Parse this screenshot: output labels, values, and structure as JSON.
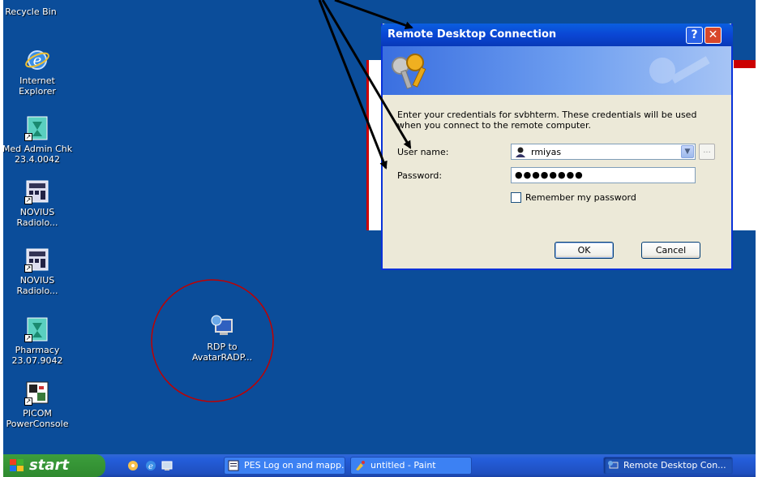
{
  "desktop": {
    "icons": [
      {
        "label": "Recycle Bin",
        "icon": "recycle-bin-icon"
      },
      {
        "label": "Internet Explorer",
        "icon": "internet-explorer-icon"
      },
      {
        "label": "Med Admin Chk 23.4.0042",
        "icon": "med-admin-icon"
      },
      {
        "label": "NOVIUS Radiolo...",
        "icon": "novius-icon"
      },
      {
        "label": "NOVIUS Radiolo...",
        "icon": "novius-icon"
      },
      {
        "label": "Pharmacy 23.07.9042",
        "icon": "pharmacy-icon"
      },
      {
        "label": "PICOM PowerConsole",
        "icon": "picom-icon"
      },
      {
        "label": "RDP to AvatarRADP...",
        "icon": "rdp-icon"
      }
    ]
  },
  "dialog": {
    "title": "Remote Desktop Connection",
    "help_label": "?",
    "close_label": "✕",
    "prompt": "Enter your credentials for svbhterm. These credentials will be used when you connect to the remote computer.",
    "username_label": "User name:",
    "username_value": "rmiyas",
    "browse_label": "...",
    "password_label": "Password:",
    "password_value": "●●●●●●●●",
    "remember_label": "Remember my password",
    "ok_label": "OK",
    "cancel_label": "Cancel"
  },
  "taskbar": {
    "start_label": "start",
    "tasks": [
      {
        "label": "PES Log on and mapp...",
        "active": false
      },
      {
        "label": "untitled - Paint",
        "active": false
      },
      {
        "label": "Remote Desktop Con...",
        "active": true
      }
    ]
  },
  "colors": {
    "desktop": "#0b4d9a",
    "title_bar": "#0a46d4",
    "dialog_face": "#ece9d8",
    "taskbar": "#245edb",
    "start": "#2f8a2f",
    "annotation_circle": "#c00000"
  }
}
